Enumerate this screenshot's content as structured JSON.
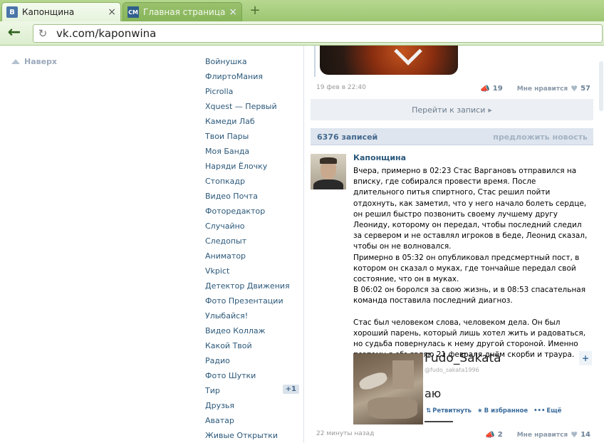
{
  "browser": {
    "tabs": [
      {
        "favicon": "В",
        "title": "Капонщина",
        "close": "×"
      },
      {
        "favicon": "СМ",
        "title": "Главная страница - С",
        "close": "×"
      }
    ],
    "new_tab": "+",
    "url": "vk.com/kaponwina"
  },
  "page": {
    "to_top": "Наверх",
    "apps": [
      {
        "label": "Войнушка"
      },
      {
        "label": "ФлиртоМания"
      },
      {
        "label": "Picrolla"
      },
      {
        "label": "Xquest — Первый"
      },
      {
        "label": "Камеди Лаб"
      },
      {
        "label": "Твои Пары"
      },
      {
        "label": "Моя Банда"
      },
      {
        "label": "Наряди Ёлочку"
      },
      {
        "label": "Стопкадр"
      },
      {
        "label": "Видео Почта"
      },
      {
        "label": "Фоторедактор"
      },
      {
        "label": "Случайно"
      },
      {
        "label": "Следопыт"
      },
      {
        "label": "Аниматор"
      },
      {
        "label": "Vkpict"
      },
      {
        "label": "Детектор Движения"
      },
      {
        "label": "Фото Презентации"
      },
      {
        "label": "Улыбайся!"
      },
      {
        "label": "Видео Коллаж"
      },
      {
        "label": "Какой Твой"
      },
      {
        "label": "Радио"
      },
      {
        "label": "Фото Шутки"
      },
      {
        "label": "Тир",
        "badge": "+1"
      },
      {
        "label": "Друзья"
      },
      {
        "label": "Аватар"
      },
      {
        "label": "Живые Открытки"
      }
    ],
    "prev_post": {
      "date": "19 фев в 22:40",
      "reposts": "19",
      "like_label": "Мне нравится",
      "likes": "57"
    },
    "goto_post": "Перейти к записи",
    "wall": {
      "count": "6376 записей",
      "suggest": "предложить новость"
    },
    "post": {
      "author": "Капонщина",
      "text": "Вчера, примерно в 02:23 Стас Варгановъ отправился на вписку, где собирался провести время. После длительного питья спиртного, Стас решил пойти отдохнуть, как заметил, что у него начало болеть сердце, он решил быстро позвонить своему лучшему другу Леониду, которому он передал, чтобы последний следил за сервером и не оставлял игроков в беде, Леонид сказал, чтобы он не волновался.\nПримерно в 05:32 он опубликовал предсмертный пост, в котором он сказал о муках, где тончайше передал свой состояние, что он в муках.\nВ 06:02 он боролся за свою жизнь, и в 08:53 спасательная команда поставила последний диагноз.\n\nСтас был человеком слова, человеком дела. Он был хороший парень, который лишь хотел жить и радоваться, но судьба повернулась к нему другой стороной. Именно поэтому я объявляю 21 февраля днём скорби и траура.",
      "attachment": {
        "name": "Fudo_Sakata",
        "handle": "@fudo_sakata1996",
        "text": "аю",
        "retweet": "Ретвитнуть",
        "favorite": "В избранное",
        "more": "Ещё",
        "corner": "+"
      },
      "date": "22 минуты назад",
      "reposts": "2",
      "like_label": "Мне нравится",
      "likes": "14"
    }
  },
  "icons": {
    "back": "back-arrow-icon",
    "reload": "reload-icon",
    "megaphone": "megaphone-icon",
    "heart": "heart-icon"
  },
  "colors": {
    "chrome_green": "#9cc672",
    "vk_link": "#2b587a",
    "vk_header": "#dee5ee"
  }
}
